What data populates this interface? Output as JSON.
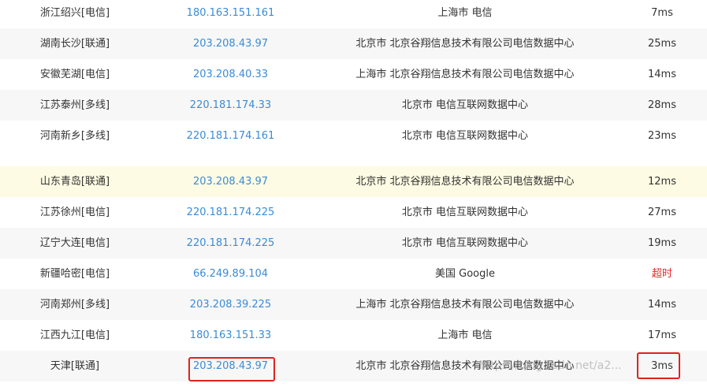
{
  "rows": [
    {
      "node": "浙江绍兴[电信]",
      "ip": "180.163.151.161",
      "location": "上海市 电信",
      "time": "7ms"
    },
    {
      "node": "湖南长沙[联通]",
      "ip": "203.208.43.97",
      "location": "北京市 北京谷翔信息技术有限公司电信数据中心",
      "time": "25ms"
    },
    {
      "node": "安徽芜湖[电信]",
      "ip": "203.208.40.33",
      "location": "上海市 北京谷翔信息技术有限公司电信数据中心",
      "time": "14ms"
    },
    {
      "node": "江苏泰州[多线]",
      "ip": "220.181.174.33",
      "location": "北京市 电信互联网数据中心",
      "time": "28ms"
    },
    {
      "node": "河南新乡[多线]",
      "ip": "220.181.174.161",
      "location": "北京市 电信互联网数据中心",
      "time": "23ms"
    },
    {
      "node": "山东青岛[联通]",
      "ip": "203.208.43.97",
      "location": "北京市 北京谷翔信息技术有限公司电信数据中心",
      "time": "12ms"
    },
    {
      "node": "江苏徐州[电信]",
      "ip": "220.181.174.225",
      "location": "北京市 电信互联网数据中心",
      "time": "27ms"
    },
    {
      "node": "辽宁大连[电信]",
      "ip": "220.181.174.225",
      "location": "北京市 电信互联网数据中心",
      "time": "19ms"
    },
    {
      "node": "新疆哈密[电信]",
      "ip": "66.249.89.104",
      "location": "美国 Google",
      "time": "超时"
    },
    {
      "node": "河南郑州[多线]",
      "ip": "203.208.39.225",
      "location": "上海市 北京谷翔信息技术有限公司电信数据中心",
      "time": "14ms"
    },
    {
      "node": "江西九江[电信]",
      "ip": "180.163.151.33",
      "location": "上海市 电信",
      "time": "17ms"
    },
    {
      "node": "天津[联通]",
      "ip": "203.208.43.97",
      "location": "北京市 北京谷翔信息技术有限公司电信数据中心",
      "time": "3ms"
    }
  ],
  "colors": {
    "ip_link": "#3a8bd6",
    "timeout": "#e02b2b",
    "highlight_row": "#fdfbe3",
    "alt_row": "#f7f7f7",
    "annotation_box": "#e0221e"
  },
  "watermark": "https://blog.csdn.net/a2..."
}
